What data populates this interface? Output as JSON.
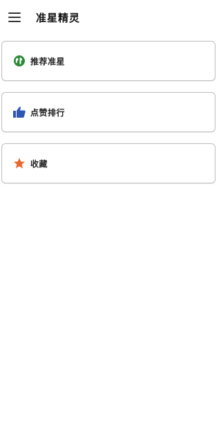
{
  "app_bar": {
    "title": "准星精灵",
    "menu_icon": "menu-icon"
  },
  "menu_items": [
    {
      "label": "推荐准星",
      "icon": "globe-icon",
      "icon_color": "#2e8b3a"
    },
    {
      "label": "点赞排行",
      "icon": "thumbs-up-icon",
      "icon_color": "#2f56b5"
    },
    {
      "label": "收藏",
      "icon": "star-icon",
      "icon_color": "#e8672a"
    }
  ]
}
